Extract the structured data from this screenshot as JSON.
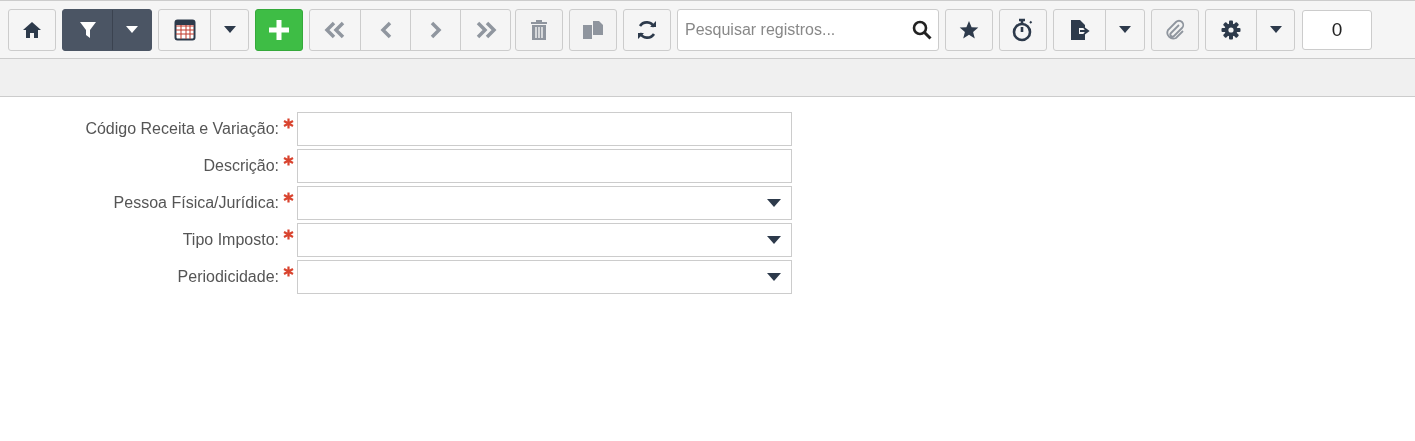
{
  "toolbar": {
    "home": {
      "disabled": false
    },
    "filter": {
      "active": true
    },
    "grid": {
      "disabled": false
    },
    "add": {
      "disabled": false
    },
    "navigation": {
      "disabled": true
    },
    "delete": {
      "disabled": true
    },
    "copy": {
      "disabled": true
    },
    "refresh": {
      "disabled": false
    },
    "search": {
      "placeholder": "Pesquisar registros..."
    },
    "favorite": {
      "disabled": false
    },
    "timer": {
      "disabled": false
    },
    "export": {
      "disabled": false
    },
    "attach": {
      "disabled": true
    },
    "settings": {
      "disabled": false
    },
    "counter": "0"
  },
  "form": {
    "fields": [
      {
        "label": "Código Receita e Variação:",
        "required": true,
        "kind": "text"
      },
      {
        "label": "Descrição:",
        "required": true,
        "kind": "text"
      },
      {
        "label": "Pessoa Física/Jurídica:",
        "required": true,
        "kind": "select"
      },
      {
        "label": "Tipo Imposto:",
        "required": true,
        "kind": "select"
      },
      {
        "label": "Periodicidade:",
        "required": true,
        "kind": "select"
      }
    ]
  }
}
